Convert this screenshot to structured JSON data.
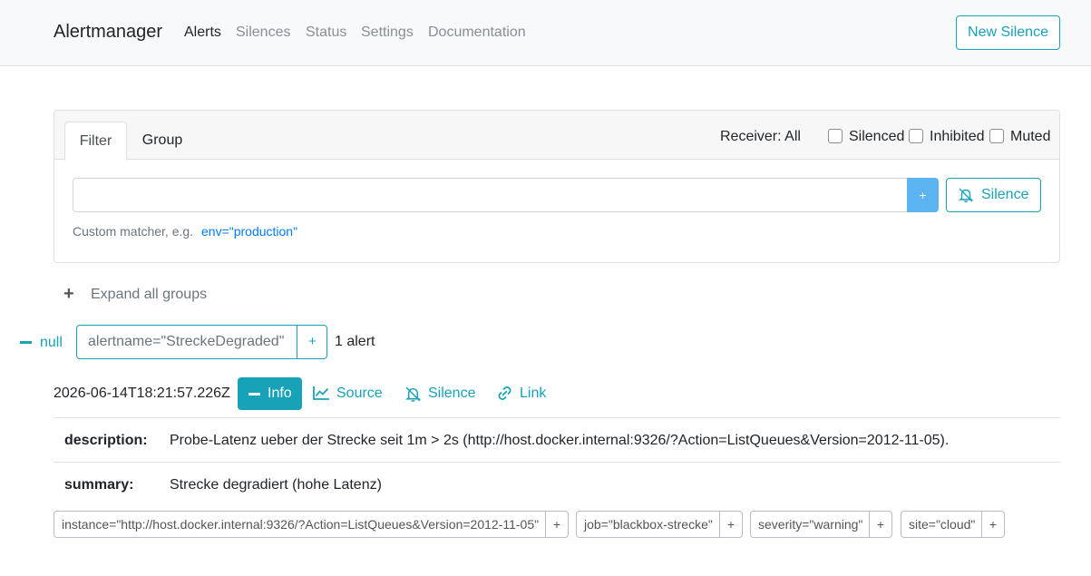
{
  "navbar": {
    "brand": "Alertmanager",
    "links": [
      "Alerts",
      "Silences",
      "Status",
      "Settings",
      "Documentation"
    ],
    "new_silence": "New Silence"
  },
  "filter_panel": {
    "tabs": [
      "Filter",
      "Group"
    ],
    "receiver": "Receiver: All",
    "checkboxes": [
      "Silenced",
      "Inhibited",
      "Muted"
    ],
    "input_value": "",
    "add_button": "+",
    "silence_button": "Silence",
    "hint_text": "Custom matcher, e.g.",
    "hint_example": "env=\"production\""
  },
  "expand_all": "Expand all groups",
  "group": {
    "receiver": "null",
    "label": "alertname=\"StreckeDegraded\"",
    "add": "+",
    "count": "1 alert"
  },
  "alert": {
    "timestamp": "2026-06-14T18:21:57.226Z",
    "info": "Info",
    "source": "Source",
    "silence": "Silence",
    "link": "Link",
    "annotations": [
      {
        "key": "description:",
        "value": "Probe-Latenz ueber der Strecke seit 1m > 2s (http://host.docker.internal:9326/?Action=ListQueues&Version=2012-11-05)."
      },
      {
        "key": "summary:",
        "value": "Strecke degradiert (hohe Latenz)"
      }
    ],
    "labels": [
      "instance=\"http://host.docker.internal:9326/?Action=ListQueues&Version=2012-11-05\"",
      "job=\"blackbox-strecke\"",
      "severity=\"warning\"",
      "site=\"cloud\""
    ],
    "label_add": "+"
  },
  "colors": {
    "accent": "#17a2b8",
    "primary_link": "#007bff",
    "navbar_bg": "#f8f9fa",
    "add_button_bg": "#5bb4f0"
  },
  "icons": [
    "bell-slash-icon",
    "chart-line-icon",
    "link-icon",
    "plus-icon",
    "minus-icon"
  ]
}
